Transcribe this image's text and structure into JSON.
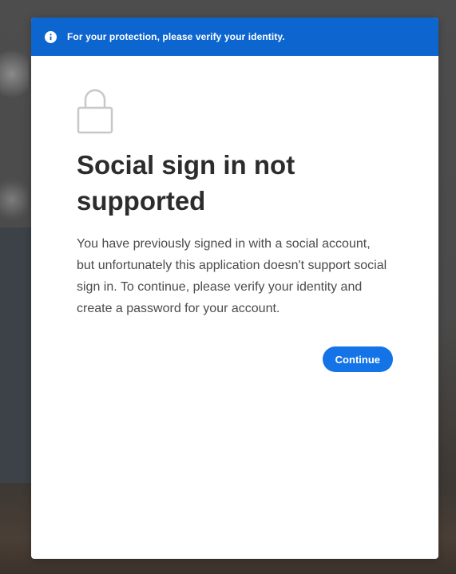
{
  "banner": {
    "icon": "info-icon",
    "text": "For your protection, please verify your identity."
  },
  "dialog": {
    "icon": "lock-icon",
    "title": "Social sign in not supported",
    "body": "You have previously signed in with a social account, but unfortunately this application doesn't support social sign in. To continue, please verify your identity and create a password for your account.",
    "continue_label": "Continue"
  },
  "colors": {
    "banner": "#0d66d0",
    "button": "#1473e6",
    "title": "#2c2c2c",
    "body": "#4b4b4b"
  }
}
